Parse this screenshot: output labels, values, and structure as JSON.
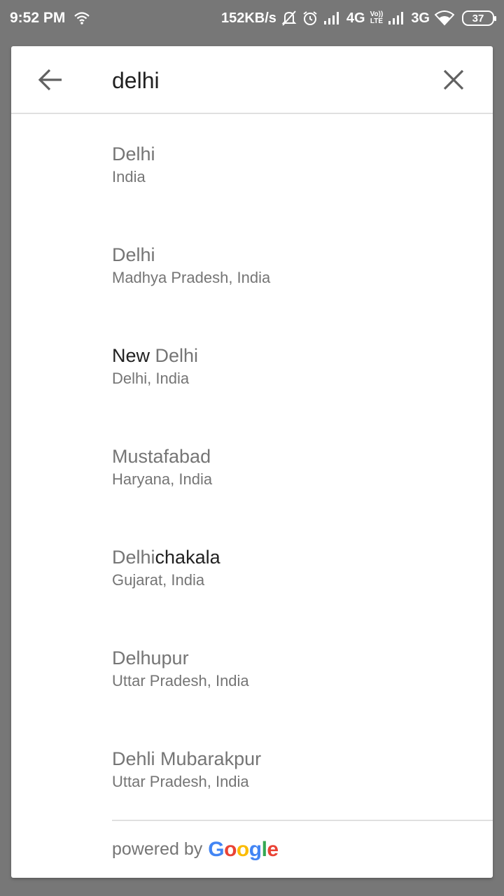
{
  "status_bar": {
    "time": "9:52 PM",
    "net_speed": "152KB/s",
    "network1": "4G",
    "volte_top": "Vo))",
    "volte_bottom": "LTE",
    "network2": "3G",
    "battery": "37"
  },
  "search": {
    "query": "delhi",
    "back_icon": "arrow-back-icon",
    "clear_icon": "close-icon"
  },
  "results": [
    {
      "title_pre": "",
      "title_match": "Delhi",
      "title_post": "",
      "subtitle": "India"
    },
    {
      "title_pre": "",
      "title_match": "Delhi",
      "title_post": "",
      "subtitle": "Madhya Pradesh, India"
    },
    {
      "title_pre": "New ",
      "title_match": "Delhi",
      "title_post": "",
      "subtitle": "Delhi, India"
    },
    {
      "title_pre": "",
      "title_match": "Mustafabad",
      "title_post": "",
      "subtitle": "Haryana, India"
    },
    {
      "title_pre": "",
      "title_match": "Delhi",
      "title_post": "chakala",
      "subtitle": "Gujarat, India"
    },
    {
      "title_pre": "",
      "title_match": "Delhupur",
      "title_post": "",
      "subtitle": "Uttar Pradesh, India"
    },
    {
      "title_pre": "",
      "title_match": "Dehli Mubarakpur",
      "title_post": "",
      "subtitle": "Uttar Pradesh, India"
    }
  ],
  "footer": {
    "powered_by": "powered by",
    "logo": [
      "G",
      "o",
      "o",
      "g",
      "l",
      "e"
    ]
  },
  "colors": {
    "highlight_text": "#212121",
    "secondary_text": "#757575",
    "google_blue": "#4285F4",
    "google_red": "#EA4335",
    "google_yellow": "#FBBC05",
    "google_green": "#34A853"
  }
}
